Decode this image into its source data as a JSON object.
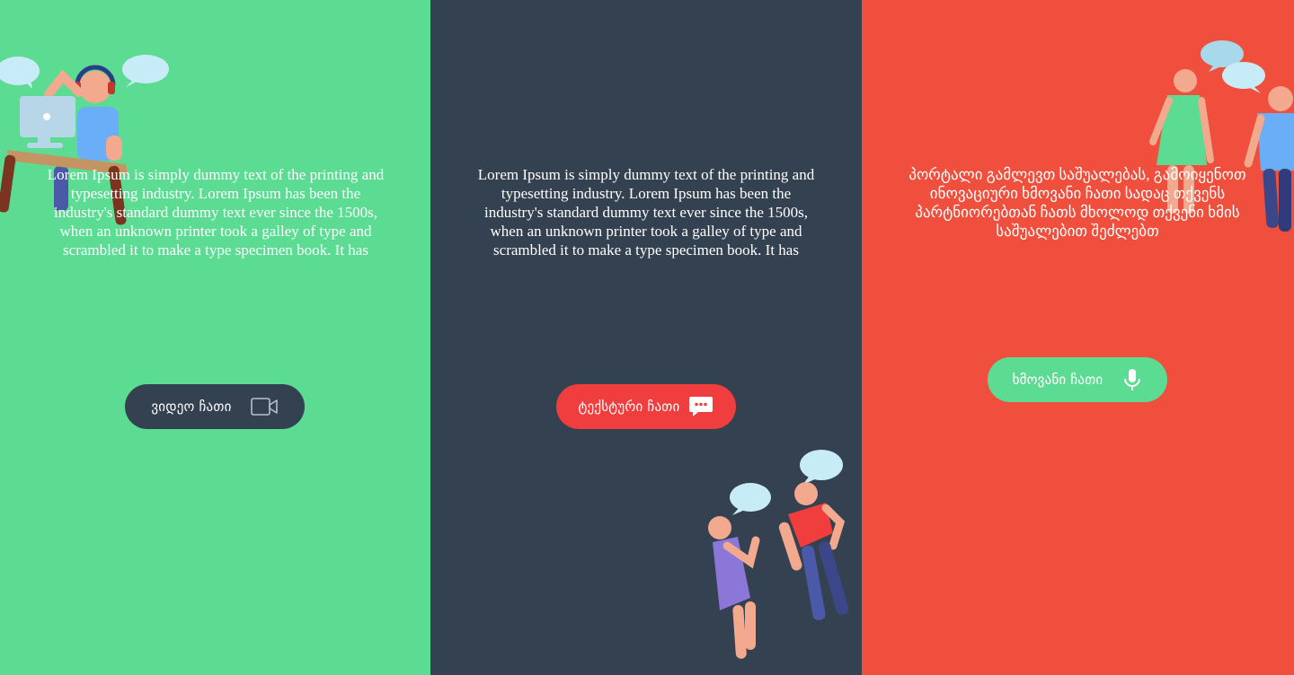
{
  "colors": {
    "green": "#5cdb93",
    "dark": "#344150",
    "red": "#f04f3d",
    "button_red": "#f03e3e",
    "text": "#ffffff"
  },
  "panels": [
    {
      "id": "video",
      "description": "Lorem Ipsum is simply dummy text of the printing and typesetting industry. Lorem Ipsum has been the industry's standard dummy text ever since the 1500s, when an unknown printer took a galley of type and scrambled it to make a type specimen book. It has",
      "button_label": "ვიდეო ჩათი",
      "button_icon": "video-camera-icon",
      "illustration": "person-at-computer"
    },
    {
      "id": "text",
      "description": "Lorem Ipsum is simply dummy text of the printing and typesetting industry. Lorem Ipsum has been the industry's standard dummy text ever since the 1500s, when an unknown printer took a galley of type and scrambled it to make a type specimen book. It has",
      "button_label": "ტექსტური ჩათი",
      "button_icon": "chat-bubble-icon",
      "illustration": "two-people-chatting"
    },
    {
      "id": "voice",
      "description": "პორტალი გამლევთ საშუალებას, გამოიყენოთ ინოვაციური ხმოვანი ჩათი სადაც თქვენს პარტნიორებთან ჩათს მხოლოდ თქვენი ხმის საშუალებით შეძლებთ",
      "button_label": "ხმოვანი ჩათი",
      "button_icon": "microphone-icon",
      "illustration": "two-people-talking"
    }
  ]
}
